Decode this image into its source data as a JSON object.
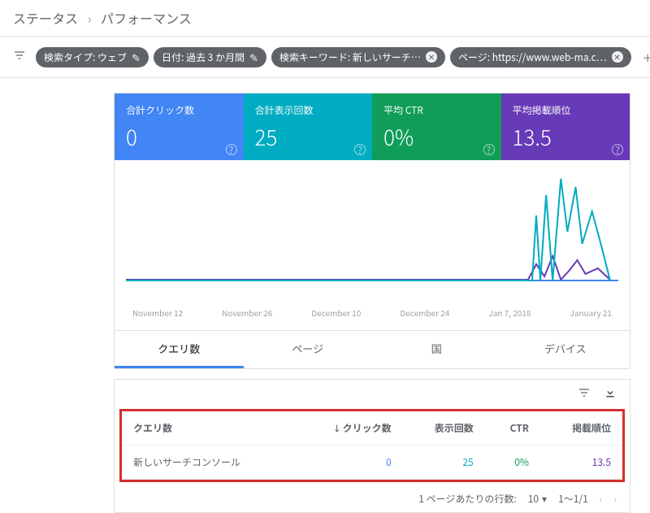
{
  "breadcrumb": {
    "parent": "ステータス",
    "current": "パフォーマンス"
  },
  "filters": {
    "type": "検索タイプ: ウェブ",
    "date": "日付: 過去 3 か月間",
    "query": "検索キーワード: 新しいサーチ…",
    "page": "ページ: https://www.web-ma.c…",
    "addnew": "新規"
  },
  "metrics": {
    "clicks": {
      "label": "合計クリック数",
      "value": "0"
    },
    "impressions": {
      "label": "合計表示回数",
      "value": "25"
    },
    "ctr": {
      "label": "平均 CTR",
      "value": "0%"
    },
    "position": {
      "label": "平均掲載順位",
      "value": "13.5"
    }
  },
  "chart_data": {
    "type": "line",
    "x_labels": [
      "November 12",
      "November 26",
      "December 10",
      "December 24",
      "Jan 7, 2018",
      "January 21"
    ],
    "series": [
      {
        "name": "クリック数",
        "color": "#4285f4",
        "values": [
          0,
          0,
          0,
          0,
          0,
          0,
          0,
          0,
          0,
          0,
          0,
          0,
          0,
          0,
          0,
          0,
          0,
          0,
          0,
          0,
          0,
          0,
          0,
          0,
          0,
          0,
          0,
          0,
          0,
          0
        ]
      },
      {
        "name": "表示回数",
        "color": "#00acc1",
        "values": [
          0,
          0,
          0,
          0,
          0,
          0,
          0,
          0,
          0,
          0,
          0,
          0,
          0,
          0,
          0,
          0,
          0,
          0,
          0,
          0,
          0,
          0,
          0,
          0,
          1,
          5,
          0,
          6,
          3,
          2
        ]
      },
      {
        "name": "掲載順位",
        "color": "#673ab7",
        "values": [
          0,
          0,
          0,
          0,
          0,
          0,
          0,
          0,
          0,
          0,
          0,
          0,
          0,
          0,
          0,
          0,
          0,
          0,
          0,
          0,
          0,
          0,
          0,
          0,
          12,
          9,
          20,
          8,
          15,
          14
        ]
      }
    ]
  },
  "tabs": [
    "クエリ数",
    "ページ",
    "国",
    "デバイス"
  ],
  "table": {
    "headers": {
      "query": "クエリ数",
      "clicks": "クリック数",
      "impressions": "表示回数",
      "ctr": "CTR",
      "position": "掲載順位"
    },
    "row": {
      "query": "新しいサーチコンソール",
      "clicks": "0",
      "impressions": "25",
      "ctr": "0%",
      "position": "13.5"
    }
  },
  "pager": {
    "label": "1 ページあたりの行数:",
    "size": "10",
    "range": "1～1/1"
  }
}
